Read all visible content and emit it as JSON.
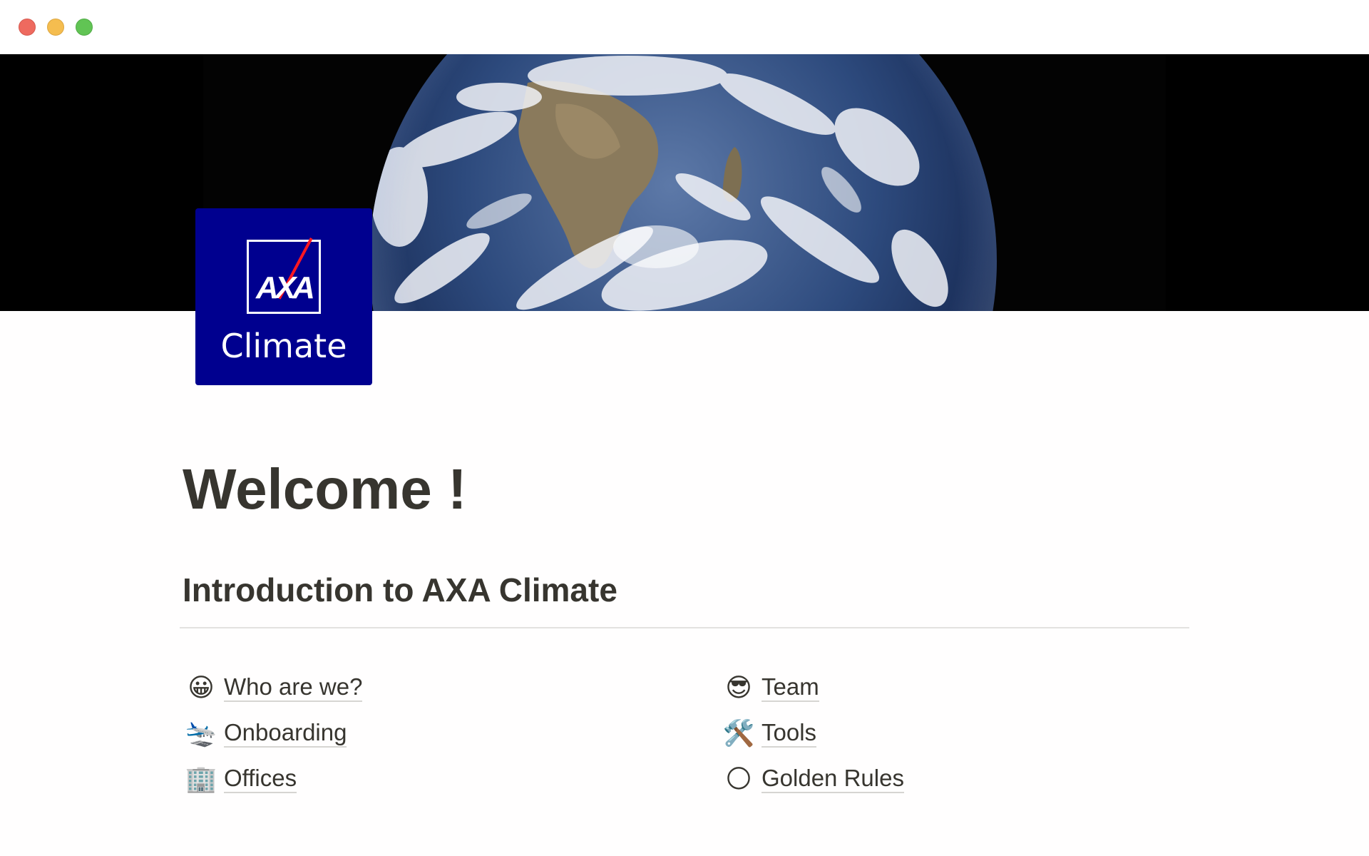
{
  "window": {
    "controls": [
      "close",
      "minimize",
      "maximize"
    ],
    "control_colors": {
      "close": "#ee6a5f",
      "minimize": "#f5bd4f",
      "maximize": "#61c454"
    }
  },
  "cover": {
    "image": "earth-from-space"
  },
  "page_icon": {
    "logo_text": "AXA",
    "caption": "Climate",
    "background": "#00008f",
    "accent": "#ff1721"
  },
  "page": {
    "title": "Welcome !",
    "section_title": "Introduction to AXA Climate"
  },
  "links": {
    "left": [
      {
        "icon": "grinning-face-icon",
        "glyph": "😀",
        "label": "Who are we?"
      },
      {
        "icon": "airplane-arriving-icon",
        "glyph": "🛬",
        "label": "Onboarding"
      },
      {
        "icon": "office-building-icon",
        "glyph": "🏢",
        "label": "Offices"
      }
    ],
    "right": [
      {
        "icon": "sunglasses-face-icon",
        "glyph": "😎",
        "label": "Team"
      },
      {
        "icon": "hammer-and-wrench-icon",
        "glyph": "🛠️",
        "label": "Tools"
      },
      {
        "icon": "full-moon-icon",
        "glyph": "🌕",
        "label": "Golden Rules"
      }
    ]
  }
}
